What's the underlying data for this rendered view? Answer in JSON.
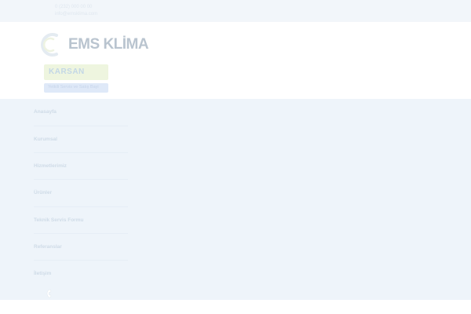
{
  "topbar": {
    "contact_line_1": "0 (232) 000 00 00",
    "contact_line_2": "info@emsklima.com"
  },
  "brand": {
    "name": "EMS KLİMA",
    "logo_icon": "swirl-logo-icon",
    "badge_text": "KARSAN",
    "sub_badge_text": "Yetkili Servis ve Satış Bayi"
  },
  "nav": {
    "items": [
      {
        "label": "Anasayfa"
      },
      {
        "label": "Kurumsal"
      },
      {
        "label": "Hizmetlerimiz"
      },
      {
        "label": "Ürünler"
      },
      {
        "label": "Teknik Servis Formu"
      },
      {
        "label": "Referanslar"
      },
      {
        "label": "İletişim"
      }
    ],
    "bottom_icon": "phone-icon"
  },
  "colors": {
    "topbar_bg": "#f2f6fa",
    "nav_bg": "#eef4fa",
    "brand_text": "#b9c4cf",
    "badge_bg": "#eef5df"
  }
}
